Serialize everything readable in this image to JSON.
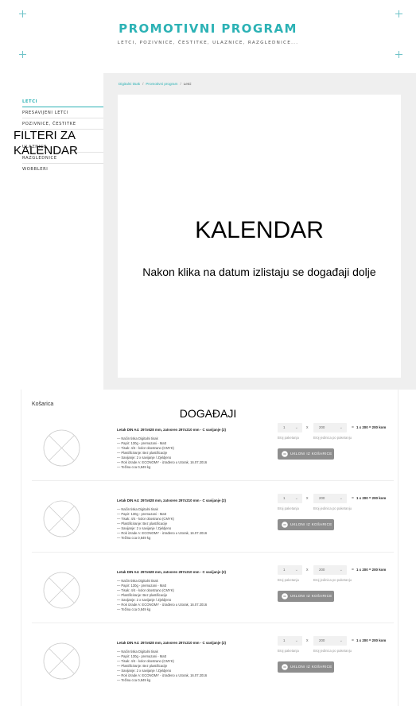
{
  "header": {
    "brand": "PROMOTIVNI PROGRAM",
    "tagline": "LETCI, POZIVNICE, ČESTITKE, ULAZNICE, RAZGLEDNICE..."
  },
  "sidebar": {
    "items": [
      {
        "label": "LETCI",
        "active": true
      },
      {
        "label": "PRESAVIJENI LETCI",
        "active": false
      },
      {
        "label": "POZIVNICE, ČESTITKE",
        "active": false
      },
      {
        "label": "ULAZNICE",
        "active": false
      },
      {
        "label": "RAZGLEDNICE",
        "active": false
      },
      {
        "label": "WOBBLERI",
        "active": false
      }
    ],
    "overlay": "FILTERI ZA KALENDAR"
  },
  "breadcrumb": {
    "items": [
      "Digitalni tisak",
      "Promotivni program",
      "Letci"
    ],
    "separator": "/"
  },
  "calendar": {
    "title": "KALENDAR",
    "subtitle": "Nakon klika na datum izlistaju se događaji dolje"
  },
  "cart": {
    "title": "Košarica",
    "events_title": "DOGAĐAJI",
    "items": [
      {
        "title": "Letak DIN A4: 297x628 mm, zatvoren 297x210 mm - C savijanje (2)",
        "details": [
          "— Način tiska Digitalni tisak",
          "— Papir: 130g - premazani - Matt",
          "— Tisak: 4/4 - kolor obostrano (CMYK)",
          "— Plastificiranje: Bez plastificacije",
          "— Savijanje: 2 x savijanje / Zjeldjeno",
          "— Rok izrade A: ECONOMY - izrađeno u Utorak, 16.07.2016",
          "— Težina cca 0,849 kg"
        ],
        "packages": "1",
        "units": "200",
        "total": "1 x 200 = 200 kom",
        "packages_label": "Broj paketanja",
        "units_label": "Broj jedinica po paketanju",
        "remove_label": "UKLONI IZ KOŠARICE"
      },
      {
        "title": "Letak DIN A4: 297x628 mm, zatvoren 297x210 mm - C savijanje (2)",
        "details": [
          "— Način tiska Digitalni tisak",
          "— Papir: 130g - premazani - Matt",
          "— Tisak: 4/4 - kolor obostrano (CMYK)",
          "— Plastificiranje: Bez plastificacije",
          "— Savijanje: 2 x savijanje / Zjeldjeno",
          "— Rok izrade A: ECONOMY - izrađeno u Utorak, 16.07.2016",
          "— Težina cca 0,849 kg"
        ],
        "packages": "1",
        "units": "200",
        "total": "1 x 200 = 200 kom",
        "packages_label": "Broj paketanja",
        "units_label": "Broj jedinica po paketanju",
        "remove_label": "UKLONI IZ KOŠARICE"
      },
      {
        "title": "Letak DIN A4: 297x628 mm, zatvoren 297x210 mm - C savijanje (2)",
        "details": [
          "— Način tiska Digitalni tisak",
          "— Papir: 130g - premazani - Matt",
          "— Tisak: 4/4 - kolor obostrano (CMYK)",
          "— Plastificiranje: Bez plastificacije",
          "— Savijanje: 2 x savijanje / Zjeldjeno",
          "— Rok izrade A: ECONOMY - izrađeno u Utorak, 16.07.2016",
          "— Težina cca 0,849 kg"
        ],
        "packages": "1",
        "units": "200",
        "total": "1 x 200 = 200 kom",
        "packages_label": "Broj paketanja",
        "units_label": "Broj jedinica po paketanju",
        "remove_label": "UKLONI IZ KOŠARICE"
      },
      {
        "title": "Letak DIN A4: 297x628 mm, zatvoren 297x210 mm - C savijanje (2)",
        "details": [
          "— Način tiska Digitalni tisak",
          "— Papir: 130g - premazani - Matt",
          "— Tisak: 4/4 - kolor obostrano (CMYK)",
          "— Plastificiranje: Bez plastificacije",
          "— Savijanje: 2 x savijanje / Zjeldjeno",
          "— Rok izrade A: ECONOMY - izrađeno u Utorak, 16.07.2016",
          "— Težina cca 0,849 kg"
        ],
        "packages": "1",
        "units": "200",
        "total": "1 x 200 = 200 kom",
        "packages_label": "Broj paketanja",
        "units_label": "Broj jedinica po paketanju",
        "remove_label": "UKLONI IZ KOŠARICE"
      }
    ]
  },
  "colors": {
    "accent": "#2cb2b5",
    "band": "#efefef",
    "button": "#8e8e8e"
  },
  "icons": [
    "plus-decor-icon",
    "placeholder-image-icon",
    "remove-icon",
    "chevron-down-icon"
  ]
}
